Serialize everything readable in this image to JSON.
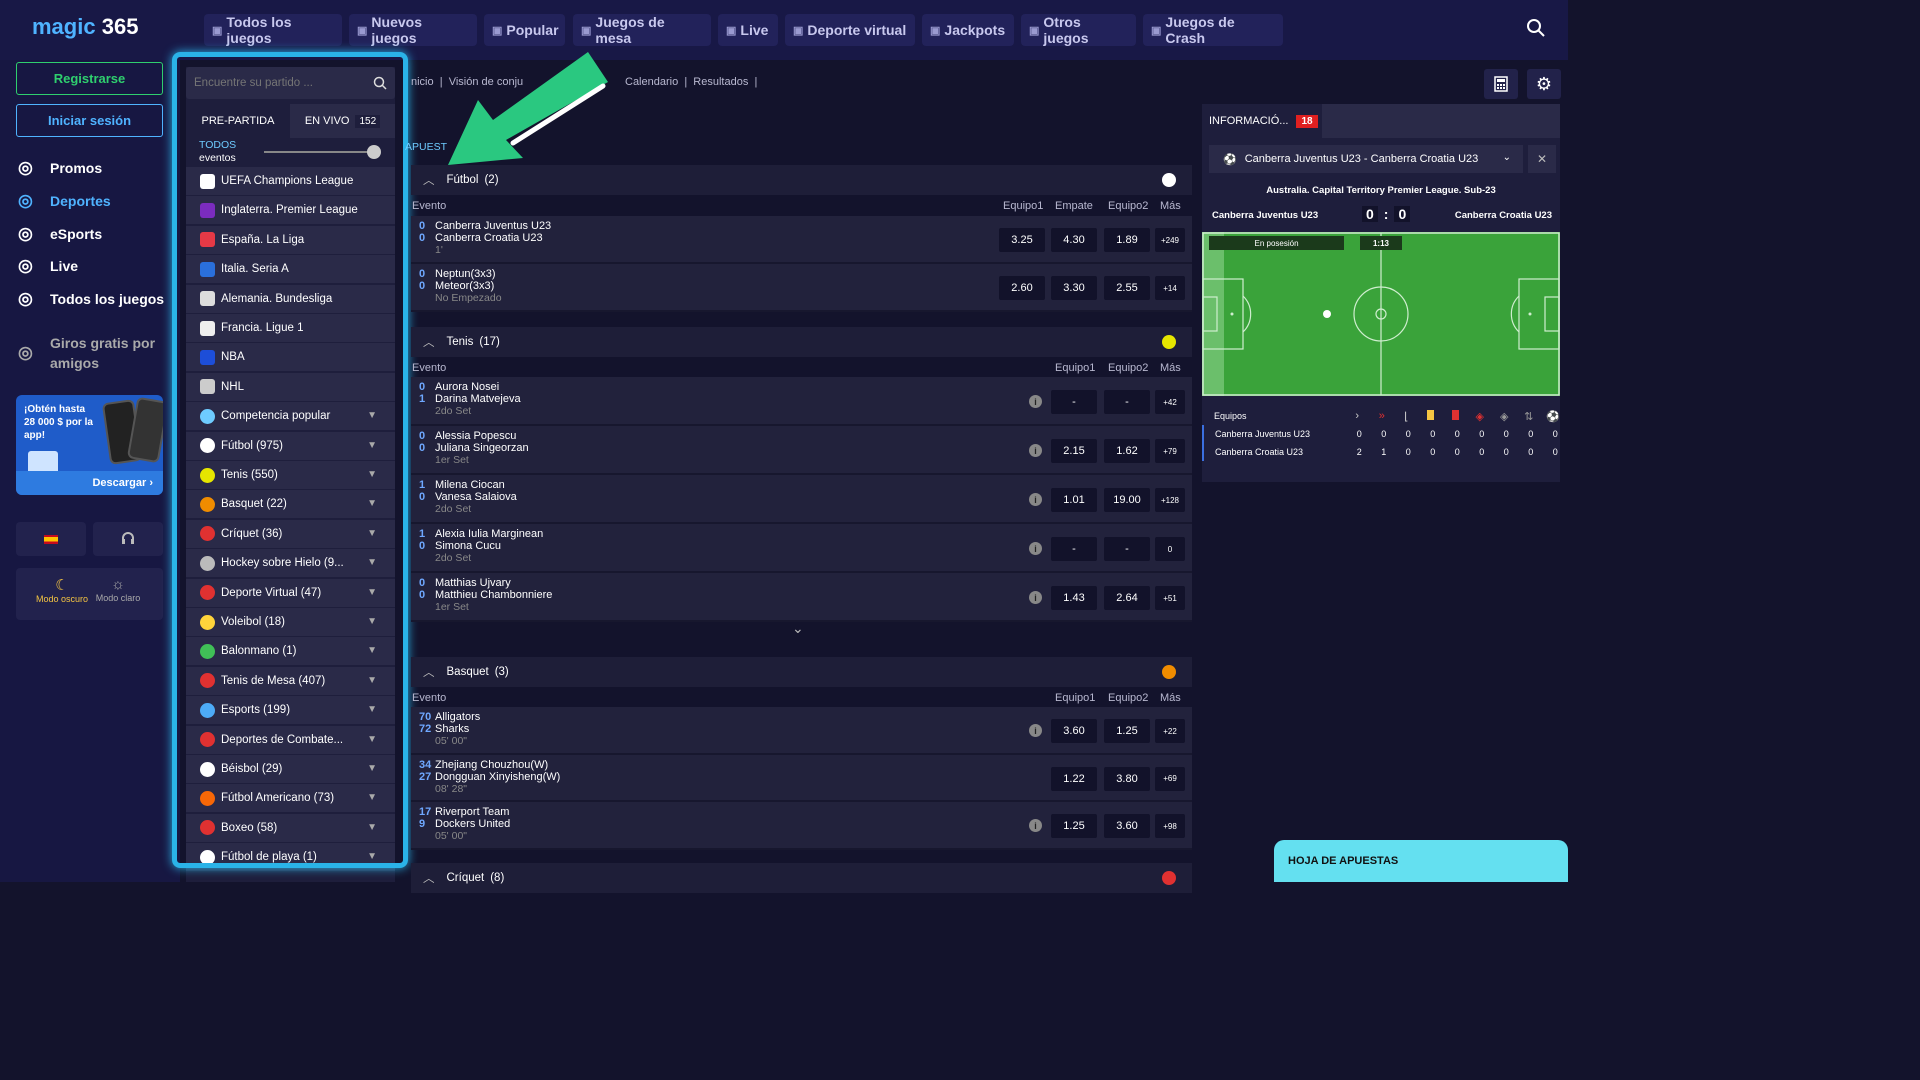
{
  "brand": {
    "name": "magic",
    "number": "365"
  },
  "topnav": [
    {
      "label": "Todos los juegos",
      "icon": "grid-icon"
    },
    {
      "label": "Nuevos juegos",
      "icon": "sparkle-icon"
    },
    {
      "label": "Popular",
      "icon": "flame-icon"
    },
    {
      "label": "Juegos de mesa",
      "icon": "cards-icon"
    },
    {
      "label": "Live",
      "icon": "dealer-icon"
    },
    {
      "label": "Deporte virtual",
      "icon": "ball-icon"
    },
    {
      "label": "Jackpots",
      "icon": "slot-icon"
    },
    {
      "label": "Otros juegos",
      "icon": "gamepad-icon"
    },
    {
      "label": "Juegos de Crash",
      "icon": "rocket-icon"
    }
  ],
  "auth": {
    "register": "Registrarse",
    "login": "Iniciar sesión"
  },
  "sidemenu": [
    {
      "label": "Promos",
      "icon": "gift-icon"
    },
    {
      "label": "Deportes",
      "icon": "ball-icon"
    },
    {
      "label": "eSports",
      "icon": "gamepad-icon"
    },
    {
      "label": "Live",
      "icon": "dealer-icon"
    },
    {
      "label": "Todos los juegos",
      "icon": "grid-icon"
    },
    {
      "label": "Giros gratis por amigos",
      "icon": "coins-icon"
    }
  ],
  "promo": {
    "text": "¡Obtén hasta 28 000 $ por la app!",
    "button": "Descargar"
  },
  "theme": {
    "dark": "Modo oscuro",
    "light": "Modo claro"
  },
  "search": {
    "placeholder": "Encuentre su partido ..."
  },
  "tabs": {
    "prematch": "PRE-PARTIDA",
    "live": "EN VIVO",
    "live_count": "152"
  },
  "filter": {
    "label1": "TODOS",
    "label2": "eventos"
  },
  "leagues": [
    {
      "label": "UEFA Champions League",
      "color": "#ffffff"
    },
    {
      "label": "Inglaterra. Premier League",
      "color": "#7b2cbf"
    },
    {
      "label": "España. La Liga",
      "color": "#e63946"
    },
    {
      "label": "Italia. Seria A",
      "color": "#2a6fdb"
    },
    {
      "label": "Alemania. Bundesliga",
      "color": "#dddddd"
    },
    {
      "label": "Francia. Ligue 1",
      "color": "#eeeeee"
    },
    {
      "label": "NBA",
      "color": "#1d4ed8"
    },
    {
      "label": "NHL",
      "color": "#cccccc"
    }
  ],
  "sports": [
    {
      "label": "Competencia popular",
      "color": "#6ecbff"
    },
    {
      "label": "Fútbol (975)",
      "color": "#ffffff"
    },
    {
      "label": "Tenis (550)",
      "color": "#e6e600"
    },
    {
      "label": "Basquet (22)",
      "color": "#f08c00"
    },
    {
      "label": "Críquet (36)",
      "color": "#e03131"
    },
    {
      "label": "Hockey sobre Hielo (9...",
      "color": "#bbbbbb"
    },
    {
      "label": "Deporte Virtual (47)",
      "color": "#e03131"
    },
    {
      "label": "Voleibol (18)",
      "color": "#ffd43b"
    },
    {
      "label": "Balonmano (1)",
      "color": "#40c057"
    },
    {
      "label": "Tenis de Mesa (407)",
      "color": "#e03131"
    },
    {
      "label": "Esports (199)",
      "color": "#4dabf7"
    },
    {
      "label": "Deportes de Combate...",
      "color": "#e03131"
    },
    {
      "label": "Béisbol (29)",
      "color": "#ffffff"
    },
    {
      "label": "Fútbol Americano (73)",
      "color": "#f76707"
    },
    {
      "label": "Boxeo (58)",
      "color": "#e03131"
    },
    {
      "label": "Fútbol de playa (1)",
      "color": "#ffffff"
    }
  ],
  "breadcrumb": {
    "a": "nicio",
    "b": "Visión de conju",
    "c": "Calendario",
    "d": "Resultados"
  },
  "bets_label": "APUEST",
  "sections": {
    "futbol": {
      "title": "Fútbol",
      "count": "(2)",
      "cols": [
        "Evento",
        "Equipo1",
        "Empate",
        "Equipo2",
        "Más"
      ]
    },
    "tenis": {
      "title": "Tenis",
      "count": "(17)",
      "cols": [
        "Evento",
        "Equipo1",
        "Equipo2",
        "Más"
      ]
    },
    "basquet": {
      "title": "Basquet",
      "count": "(3)",
      "cols": [
        "Evento",
        "Equipo1",
        "Equipo2",
        "Más"
      ]
    },
    "criquet": {
      "title": "Críquet",
      "count": "(8)"
    }
  },
  "futbol_events": [
    {
      "s1": "0",
      "t1": "Canberra Juventus U23",
      "s2": "0",
      "t2": "Canberra Croatia U23",
      "status": "1'",
      "o1": "3.25",
      "ox": "4.30",
      "o2": "1.89",
      "more": "+249"
    },
    {
      "s1": "0",
      "t1": "Neptun(3x3)",
      "s2": "0",
      "t2": "Meteor(3x3)",
      "status": "No Empezado",
      "o1": "2.60",
      "ox": "3.30",
      "o2": "2.55",
      "more": "+14"
    }
  ],
  "tenis_events": [
    {
      "s1": "0",
      "t1": "Aurora Nosei",
      "s2": "1",
      "t2": "Darina Matvejeva",
      "status": "2do Set",
      "o1": "-",
      "o2": "-",
      "more": "+42"
    },
    {
      "s1": "0",
      "t1": "Alessia Popescu",
      "s2": "0",
      "t2": "Juliana Singeorzan",
      "status": "1er Set",
      "o1": "2.15",
      "o2": "1.62",
      "more": "+79"
    },
    {
      "s1": "1",
      "t1": "Milena Ciocan",
      "s2": "0",
      "t2": "Vanesa Salaiova",
      "status": "2do Set",
      "o1": "1.01",
      "o2": "19.00",
      "more": "+128"
    },
    {
      "s1": "1",
      "t1": "Alexia Iulia Marginean",
      "s2": "0",
      "t2": "Simona Cucu",
      "status": "2do Set",
      "o1": "-",
      "o2": "-",
      "more": "0"
    },
    {
      "s1": "0",
      "t1": "Matthias Ujvary",
      "s2": "0",
      "t2": "Matthieu Chambonniere",
      "status": "1er Set",
      "o1": "1.43",
      "o2": "2.64",
      "more": "+51"
    }
  ],
  "basquet_events": [
    {
      "s1": "70",
      "t1": "Alligators",
      "s2": "72",
      "t2": "Sharks",
      "status": "05' 00\"",
      "o1": "3.60",
      "o2": "1.25",
      "more": "+22"
    },
    {
      "s1": "34",
      "t1": "Zhejiang Chouzhou(W)",
      "s2": "27",
      "t2": "Dongguan Xinyisheng(W)",
      "status": "08' 28\"",
      "o1": "1.22",
      "o2": "3.80",
      "more": "+69"
    },
    {
      "s1": "17",
      "t1": "Riverport Team",
      "s2": "9",
      "t2": "Dockers United",
      "status": "05' 00\"",
      "o1": "1.25",
      "o2": "3.60",
      "more": "+98"
    }
  ],
  "info": {
    "tab": "INFORMACIÓ...",
    "badge": "18",
    "match_select": "Canberra Juventus U23 - Canberra Croatia U23",
    "league": "Australia. Capital Territory Premier League. Sub-23",
    "home": "Canberra Juventus U23",
    "away": "Canberra Croatia U23",
    "score_home": "0",
    "score_away": "0",
    "possession": "En posesión",
    "time": "1:13",
    "table_header": "Equipos",
    "rows": [
      {
        "team": "Canberra Juventus U23",
        "vals": [
          "0",
          "0",
          "0",
          "0",
          "0",
          "0",
          "0",
          "0",
          "0"
        ]
      },
      {
        "team": "Canberra Croatia U23",
        "vals": [
          "2",
          "1",
          "0",
          "0",
          "0",
          "0",
          "0",
          "0",
          "0"
        ]
      }
    ]
  },
  "betslip": "HOJA DE APUESTAS"
}
